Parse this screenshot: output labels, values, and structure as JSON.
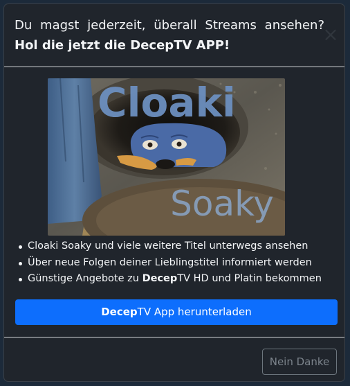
{
  "modal": {
    "title_line1": "Du magst jederzeit, überall Streams ansehen?",
    "title_line2_prefix": "Hol die jetzt die ",
    "title_line2_brand_bold": "Decep",
    "title_line2_brand_rest": "TV APP!",
    "close_label": "×"
  },
  "hero": {
    "overlay_title": "Cloaki",
    "overlay_subtitle": "Soaky"
  },
  "features": [
    {
      "text": "Cloaki Soaky und viele weitere Titel unterwegs ansehen"
    },
    {
      "text": "Über neue Folgen deiner Lieblingstitel informiert werden"
    },
    {
      "prefix": "Günstige Angebote zu ",
      "brand_bold": "Decep",
      "suffix": "TV HD und Platin bekommen"
    }
  ],
  "cta": {
    "brand_bold": "Decep",
    "label_rest": "TV App herunterladen"
  },
  "dismiss": {
    "label": "Nein Danke"
  },
  "colors": {
    "modal_bg": "#20252c",
    "primary": "#0d6efd",
    "text": "#f3f5f7",
    "secondary": "#6c757d"
  }
}
